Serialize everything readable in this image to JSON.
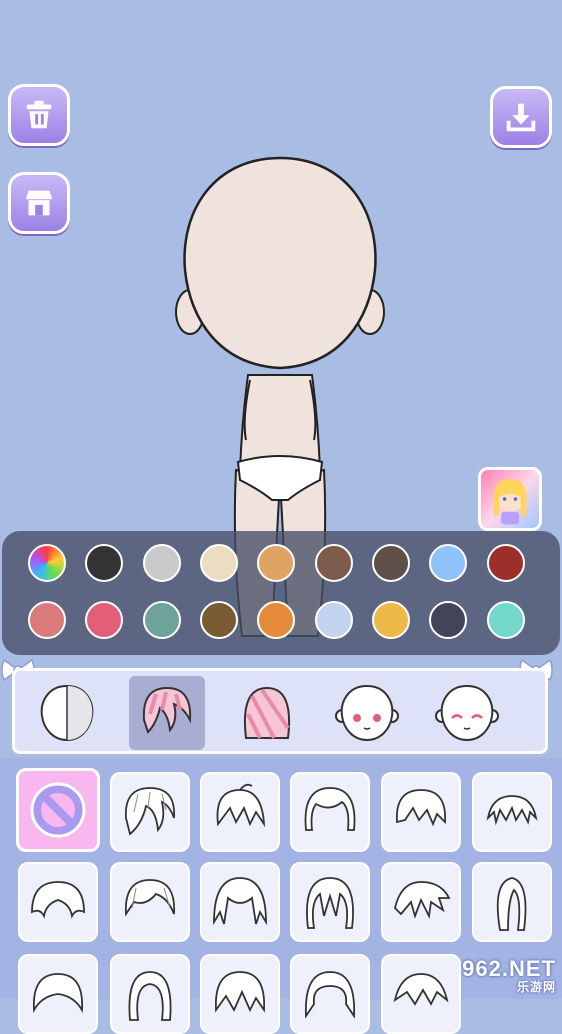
{
  "toolbar": {
    "trash_icon": "trash-icon",
    "shop_icon": "shop-icon",
    "download_icon": "download-icon"
  },
  "palette": {
    "row1": [
      "rainbow",
      "#333333",
      "#c9c9c9",
      "#ecdcc2",
      "#e1a361",
      "#7c5b4a",
      "#5e4f48",
      "#8fc2fb",
      "#9d2f2a"
    ],
    "row2": [
      "#da7a7b",
      "#e35f78",
      "#6ea39c",
      "#7a5c32",
      "#e48a3a",
      "#c1d3ee",
      "#eeb947",
      "#424459",
      "#74d7cc"
    ]
  },
  "tabs": [
    {
      "name": "body",
      "selected": false
    },
    {
      "name": "hair-front",
      "selected": true
    },
    {
      "name": "hair-back",
      "selected": false
    },
    {
      "name": "face",
      "selected": false
    },
    {
      "name": "expression",
      "selected": false
    }
  ],
  "hair_items": 17,
  "watermark": {
    "brand": "962.NET",
    "sub": "乐游网"
  }
}
